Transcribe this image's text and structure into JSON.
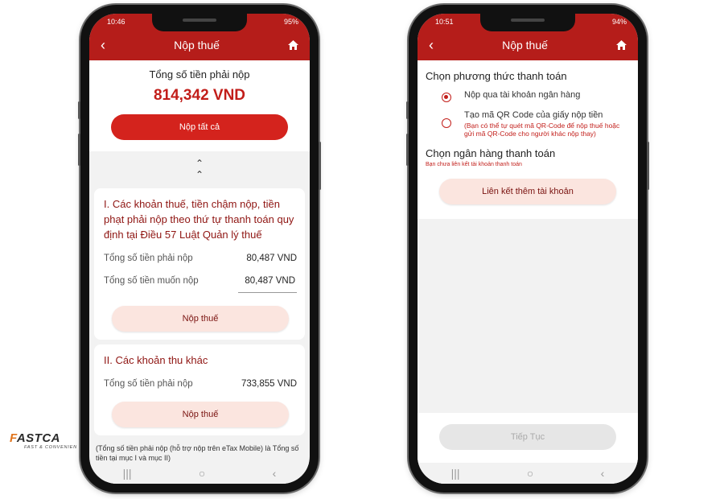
{
  "left": {
    "status": {
      "time": "10:46",
      "battery": "95%"
    },
    "header": {
      "title": "Nộp thuế"
    },
    "summary": {
      "label": "Tổng số tiền phải nộp",
      "amount": "814,342 VND",
      "pay_all_label": "Nộp tất cả"
    },
    "section1": {
      "title": "I. Các khoản thuế, tiền chậm nộp, tiền phạt phải nộp theo thứ tự thanh toán quy định tại Điều 57 Luật Quản lý thuế",
      "row1_label": "Tổng số tiền phải nộp",
      "row1_value": "80,487 VND",
      "row2_label": "Tổng số tiền muốn nộp",
      "row2_value": "80,487  VND",
      "button_label": "Nộp thuế"
    },
    "section2": {
      "title": "II. Các khoản thu khác",
      "row1_label": "Tổng số tiền phải nộp",
      "row1_value": "733,855 VND",
      "button_label": "Nộp thuế"
    },
    "note": "(Tổng số tiền phải nộp (hỗ trợ nộp trên eTax Mobile) là Tổng số tiền tại mục I và mục II)"
  },
  "right": {
    "status": {
      "time": "10:51",
      "battery": "94%"
    },
    "header": {
      "title": "Nộp thuế"
    },
    "method_title": "Chọn phương thức thanh toán",
    "option1_label": "Nộp qua tài khoản ngân hàng",
    "option2_label": "Tạo mã QR Code của giấy nộp tiền",
    "option2_sub": "(Bạn có thể tự quét mã QR-Code để nộp thuế hoặc gửi mã QR-Code cho người khác nộp thay)",
    "bank_title": "Chọn ngân hàng thanh toán",
    "bank_note": "Bạn chưa liên kết tài khoản thanh toán",
    "link_button_label": "Liên kết thêm tài khoản",
    "continue_label": "Tiếp Tục"
  },
  "logo": {
    "word_prefix": "F",
    "word_rest": "ASTCA",
    "tagline": "FAST & CONVENIEN"
  },
  "colors": {
    "header_red": "#b51d1a",
    "accent_red": "#d4231d",
    "button_pink": "#fbe5df"
  }
}
